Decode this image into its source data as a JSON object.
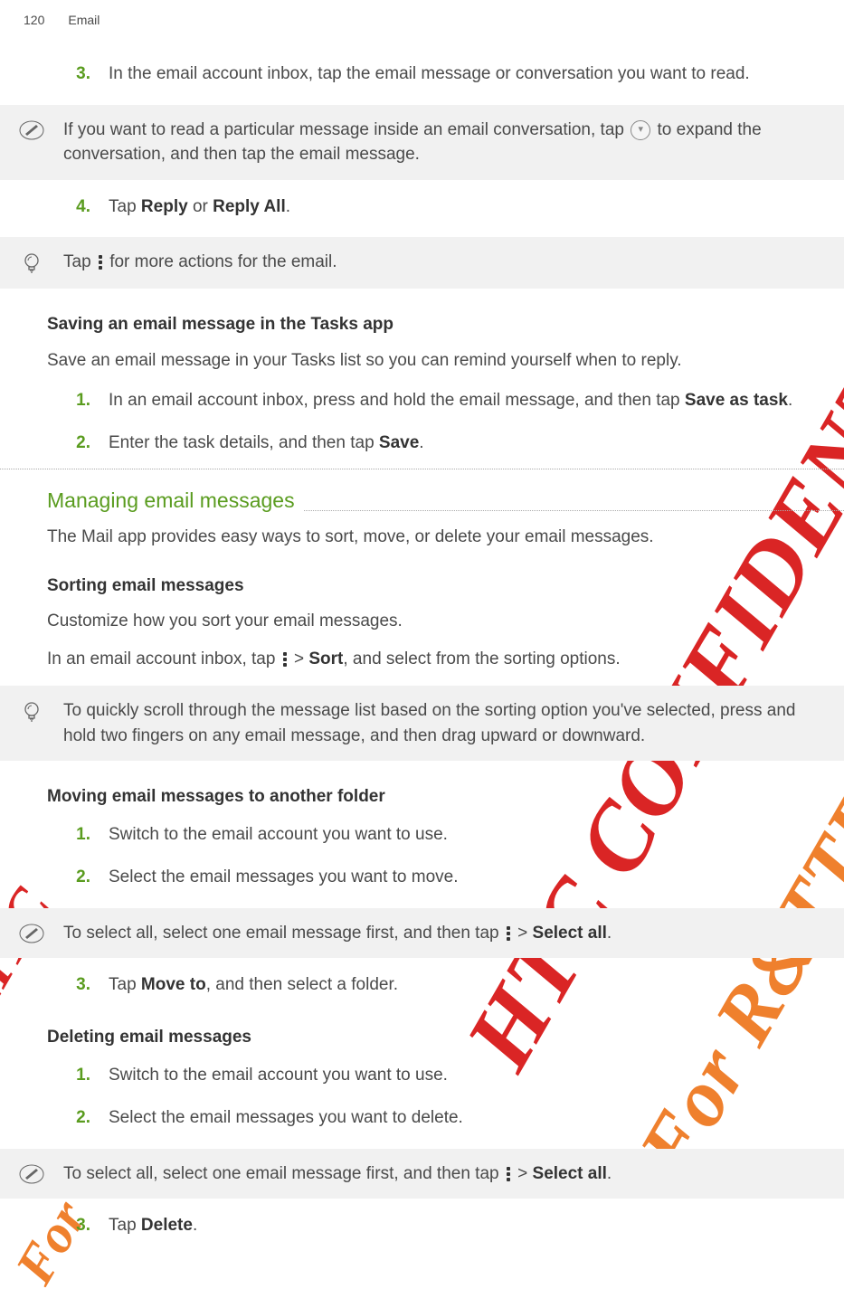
{
  "header": {
    "pageNumber": "120",
    "sectionTitle": "Email"
  },
  "watermark": {
    "red": "HTC CONFIDENTIAL",
    "orange": "For R&TTE Certification only"
  },
  "steps_a": [
    {
      "n": "3.",
      "text": "In the email account inbox, tap the email message or conversation you want to read."
    }
  ],
  "callout_a": {
    "pre": "If you want to read a particular message inside an email conversation, tap ",
    "post": " to expand the conversation, and then tap the email message."
  },
  "steps_b": [
    {
      "n": "4.",
      "pre": "Tap ",
      "b1": "Reply",
      "mid": " or ",
      "b2": "Reply All",
      "post": "."
    }
  ],
  "callout_b": {
    "pre": "Tap ",
    "post": " for more actions for the email."
  },
  "saving": {
    "heading": "Saving an email message in the Tasks app",
    "intro": "Save an email message in your Tasks list so you can remind yourself when to reply.",
    "step1_pre": "In an email account inbox, press and hold the email message, and then tap ",
    "step1_bold": "Save as task",
    "step1_post": ".",
    "step2_pre": "Enter the task details, and then tap ",
    "step2_bold": "Save",
    "step2_post": "."
  },
  "managing": {
    "title": "Managing email messages",
    "intro": "The Mail app provides easy ways to sort, move, or delete your email messages."
  },
  "sorting": {
    "heading": "Sorting email messages",
    "intro": "Customize how you sort your email messages.",
    "line_pre": "In an email account inbox, tap ",
    "line_mid": " > ",
    "line_bold": "Sort",
    "line_post": ", and select from the sorting options."
  },
  "callout_c": "To quickly scroll through the message list based on the sorting option you've selected, press and hold two fingers on any email message, and then drag upward or downward.",
  "moving": {
    "heading": "Moving email messages to another folder",
    "step1": "Switch to the email account you want to use.",
    "step2": "Select the email messages you want to move."
  },
  "callout_d": {
    "pre": "To select all, select one email message first, and then tap ",
    "mid": " > ",
    "bold": "Select all",
    "post": "."
  },
  "steps_move": {
    "n": "3.",
    "pre": "Tap ",
    "bold": "Move to",
    "post": ", and then select a folder."
  },
  "deleting": {
    "heading": "Deleting email messages",
    "step1": "Switch to the email account you want to use.",
    "step2": "Select the email messages you want to delete."
  },
  "callout_e": {
    "pre": "To select all, select one email message first, and then tap ",
    "mid": " > ",
    "bold": "Select all",
    "post": "."
  },
  "steps_delete": {
    "n": "3.",
    "pre": "Tap ",
    "bold": "Delete",
    "post": "."
  },
  "numbers": {
    "one": "1.",
    "two": "2."
  }
}
